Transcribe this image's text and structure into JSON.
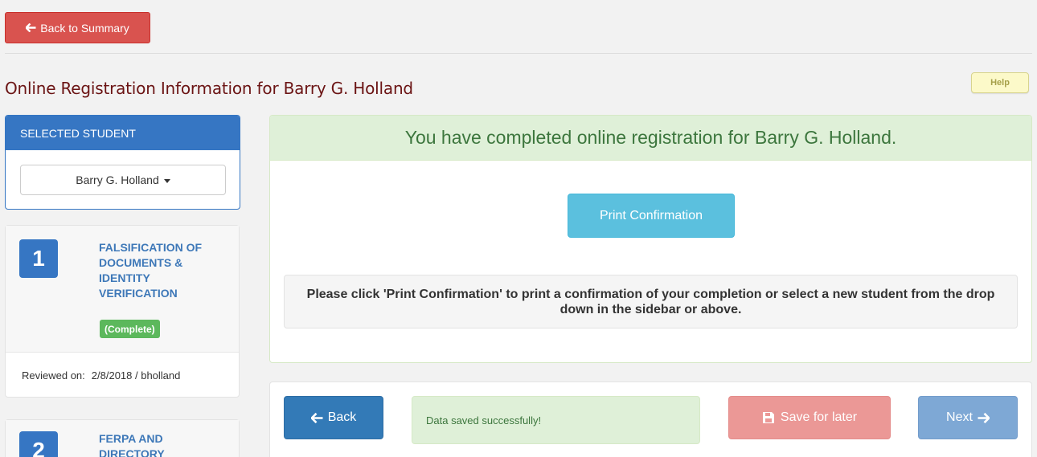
{
  "header": {
    "back_to_summary_label": "Back to Summary",
    "page_title": "Online Registration Information for Barry G. Holland",
    "help_label": "Help"
  },
  "sidebar": {
    "selected_student_header": "SELECTED STUDENT",
    "selected_student_value": "Barry G. Holland",
    "steps": [
      {
        "number": "1",
        "title": "FALSIFICATION OF DOCUMENTS & IDENTITY VERIFICATION",
        "status": "(Complete)",
        "reviewed_label": "Reviewed on:",
        "reviewed_value": "2/8/2018 / bholland"
      },
      {
        "number": "2",
        "title": "FERPA AND DIRECTORY"
      }
    ]
  },
  "main": {
    "completion_message": "You have completed online registration for Barry G. Holland.",
    "print_button_label": "Print Confirmation",
    "instruction_text": "Please click 'Print Confirmation' to print a confirmation of your completion or select a new student from the drop down in the sidebar or above."
  },
  "nav": {
    "back_label": "Back",
    "status_message": "Data saved successfully!",
    "save_later_label": "Save for later",
    "next_label": "Next"
  },
  "colors": {
    "danger": "#d9534f",
    "primary": "#3676c3",
    "success": "#5cb85c",
    "info": "#5bc0de",
    "title_maroon": "#6b1414"
  },
  "icons": {
    "back_to_summary": "arrow-left-icon",
    "dropdown": "caret-down-icon",
    "back": "arrow-left-icon",
    "save": "save-icon",
    "next": "arrow-right-icon"
  }
}
